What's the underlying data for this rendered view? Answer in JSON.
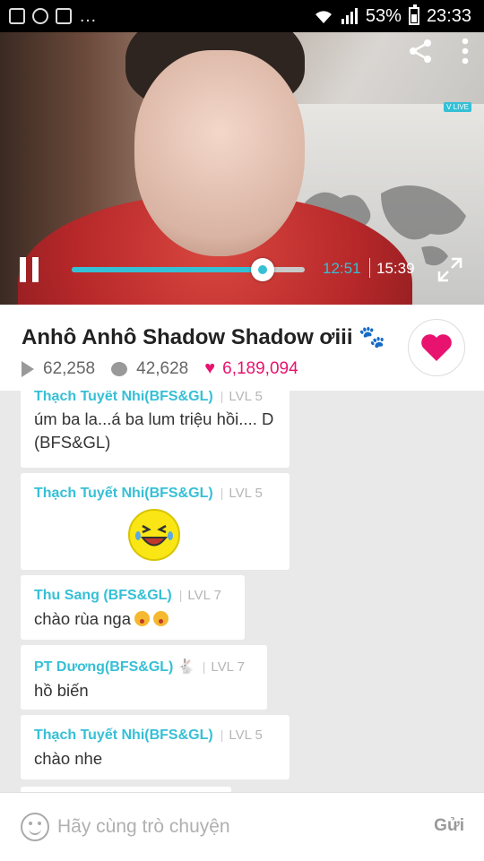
{
  "status_bar": {
    "battery": "53%",
    "time": "23:33"
  },
  "video": {
    "current_time": "12:51",
    "total_time": "15:39",
    "progress": 0.82,
    "badge": "V LIVE"
  },
  "info": {
    "title": "Anhô Anhô Shadow Shadow ơiii 🐾",
    "plays": "62,258",
    "comments": "42,628",
    "likes": "6,189,094"
  },
  "messages": [
    {
      "name": "Thạch Tuyết Nhi(BFS&GL)",
      "level": "LVL 5",
      "text": "úm ba la...á ba lum triệu hồi.... D (BFS&GL)"
    },
    {
      "name": "Thạch Tuyết Nhi(BFS&GL)",
      "level": "LVL 5",
      "text": ""
    },
    {
      "name": "Thu Sang (BFS&GL)",
      "level": "LVL 7",
      "text": "chào rùa nga"
    },
    {
      "name": "PT Dương(BFS&GL) 🐇",
      "level": "LVL 7",
      "text": "hồ biến"
    },
    {
      "name": "Thạch Tuyết Nhi(BFS&GL)",
      "level": "LVL 5",
      "text": "chào nhe"
    }
  ],
  "input": {
    "placeholder": "Hãy cùng trò chuyện",
    "send_label": "Gửi"
  },
  "colors": {
    "accent": "#35c0d6",
    "heart": "#e8136e"
  }
}
